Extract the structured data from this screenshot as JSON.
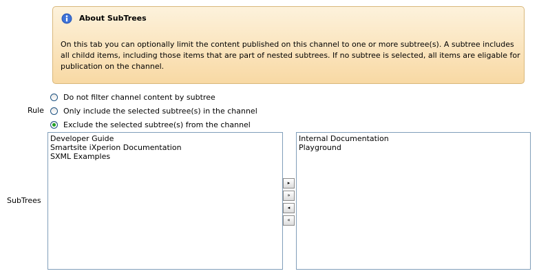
{
  "info": {
    "title": "About SubTrees",
    "text": "On this tab you can optionally limit the content published on this channel to one or more subtree(s). A subtree includes all childd items, including those items that are part of nested subtrees. If no subtree is selected, all items are eligable for publication on the channel."
  },
  "rule": {
    "label": "Rule",
    "options": [
      {
        "label": "Do not filter channel content by subtree",
        "checked": false
      },
      {
        "label": "Only include the selected subtree(s) in the channel",
        "checked": false
      },
      {
        "label": "Exclude the selected subtree(s) from the channel",
        "checked": true
      }
    ]
  },
  "subtrees": {
    "label": "SubTrees",
    "available": [
      "Developer Guide",
      "Smartsite iXperion Documentation",
      "SXML Examples"
    ],
    "selected": [
      "Internal Documentation",
      "Playground"
    ],
    "buttons": {
      "add": "▸",
      "add_all": "»",
      "remove": "◂",
      "remove_all": "«"
    }
  },
  "colors": {
    "info_border": "#d8b77a",
    "info_bg_top": "#fdf2dc",
    "info_bg_bottom": "#f8d9a4",
    "radio_check": "#21a121"
  }
}
